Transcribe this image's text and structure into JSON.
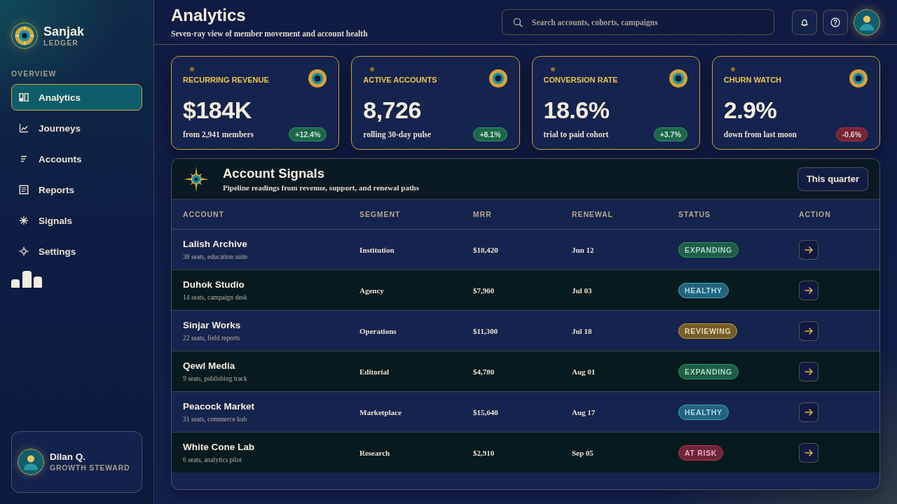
{
  "sidebar": {
    "brand": "Sanjak",
    "tagline": "LEDGER",
    "section": "OVERVIEW",
    "items": [
      {
        "label": "Analytics",
        "selected": true
      },
      {
        "label": "Journeys",
        "selected": false
      },
      {
        "label": "Accounts",
        "selected": false
      },
      {
        "label": "Reports",
        "selected": false
      },
      {
        "label": "Signals",
        "selected": false
      },
      {
        "label": "Settings",
        "selected": false
      }
    ],
    "user": {
      "name": "Dilan Q.",
      "role": "GROWTH STEWARD"
    }
  },
  "header": {
    "title": "Analytics",
    "subtitle": "Seven-ray view of member movement and account health",
    "search": {
      "placeholder": "Search accounts, cohorts, campaigns"
    }
  },
  "kpis": [
    {
      "label": "RECURRING REVENUE",
      "value": "$184K",
      "note": "from 2,941 members",
      "trend": {
        "label": "+12.4%",
        "color": "#2a9a62"
      }
    },
    {
      "label": "ACTIVE ACCOUNTS",
      "value": "8,726",
      "note": "rolling 30-day pulse",
      "trend": {
        "label": "+8.1%",
        "color": "#2a9a62"
      }
    },
    {
      "label": "CONVERSION RATE",
      "value": "18.6%",
      "note": "trial to paid cohort",
      "trend": {
        "label": "+3.7%",
        "color": "#2a9a62"
      }
    },
    {
      "label": "CHURN WATCH",
      "value": "2.9%",
      "note": "down from last moon",
      "trend": {
        "label": "-0.6%",
        "color": "#b8303f"
      }
    }
  ],
  "table": {
    "title": "Account Signals",
    "subtitle": "Pipeline readings from revenue, support, and renewal paths",
    "range_button": "This quarter",
    "columns": [
      "ACCOUNT",
      "SEGMENT",
      "MRR",
      "RENEWAL",
      "STATUS",
      "ACTION"
    ],
    "rows": [
      {
        "account": "Lalish Archive",
        "detail": "38 seats, education suite",
        "segment": "Institution",
        "mrr": "$18,420",
        "renewal": "Jun 12",
        "status": {
          "label": "EXPANDING",
          "color": "#2e9a62"
        }
      },
      {
        "account": "Duhok Studio",
        "detail": "14 seats, campaign desk",
        "segment": "Agency",
        "mrr": "$7,960",
        "renewal": "Jul 03",
        "status": {
          "label": "HEALTHY",
          "color": "#3aa6c6"
        }
      },
      {
        "account": "Sinjar Works",
        "detail": "22 seats, field reports",
        "segment": "Operations",
        "mrr": "$11,300",
        "renewal": "Jul 18",
        "status": {
          "label": "REVIEWING",
          "color": "#c99a2e"
        }
      },
      {
        "account": "Qewl Media",
        "detail": "9 seats, publishing track",
        "segment": "Editorial",
        "mrr": "$4,780",
        "renewal": "Aug 01",
        "status": {
          "label": "EXPANDING",
          "color": "#2e9a62"
        }
      },
      {
        "account": "Peacock Market",
        "detail": "31 seats, commerce hub",
        "segment": "Marketplace",
        "mrr": "$15,640",
        "renewal": "Aug 17",
        "status": {
          "label": "HEALTHY",
          "color": "#3aa6c6"
        }
      },
      {
        "account": "White Cone Lab",
        "detail": "6 seats, analytics pilot",
        "segment": "Research",
        "mrr": "$2,910",
        "renewal": "Sep 05",
        "status": {
          "label": "AT RISK",
          "color": "#c0354a"
        }
      }
    ]
  }
}
